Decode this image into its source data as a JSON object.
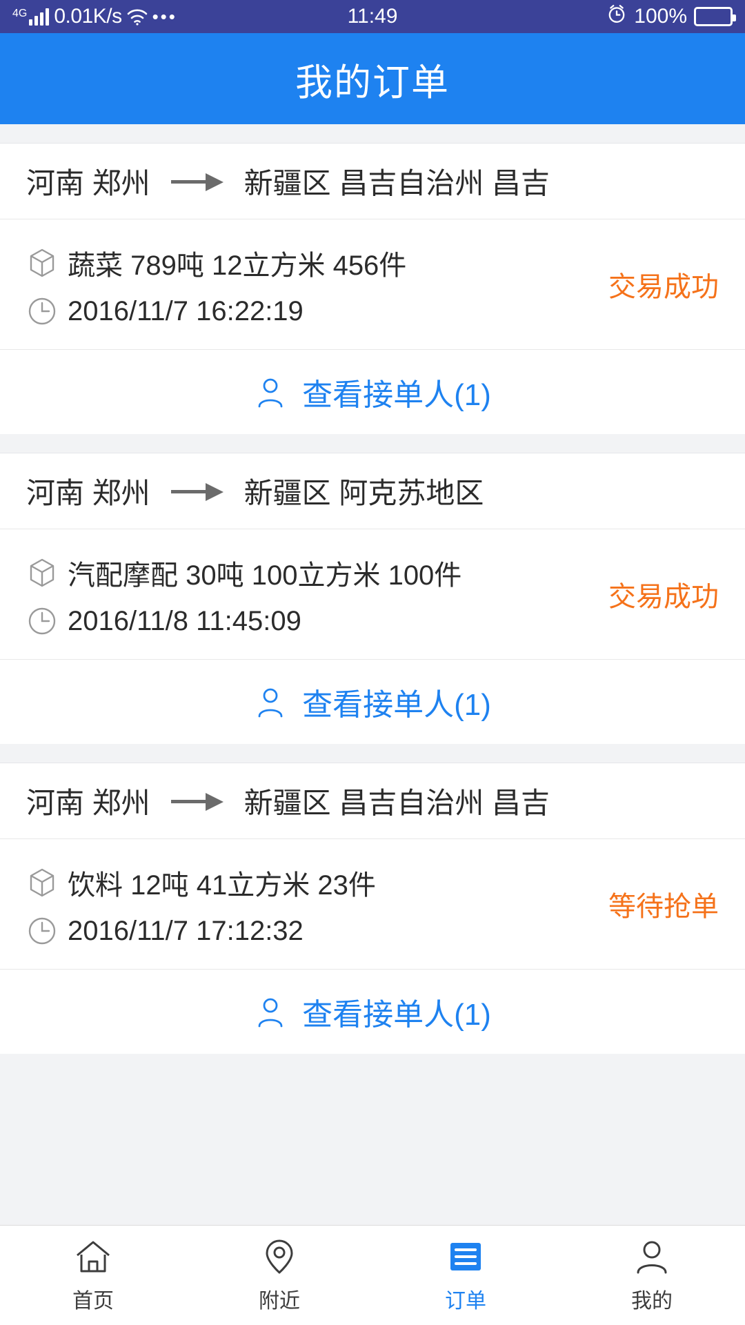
{
  "status_bar": {
    "network_type": "4G",
    "net_speed": "0.01K/s",
    "time": "11:49",
    "battery_percent": "100%",
    "icons": [
      "signal-bars-icon",
      "wifi-icon",
      "more-dots-icon",
      "alarm-clock-icon",
      "battery-icon"
    ]
  },
  "header": {
    "title": "我的订单"
  },
  "orders": [
    {
      "origin": "河南 郑州",
      "destination": "新疆区 昌吉自治州 昌吉",
      "cargo": "蔬菜 789吨 12立方米 456件",
      "time": "2016/11/7 16:22:19",
      "status": "交易成功",
      "viewer_label": "查看接单人(1)"
    },
    {
      "origin": "河南 郑州",
      "destination": "新疆区 阿克苏地区",
      "cargo": "汽配摩配 30吨 100立方米 100件",
      "time": "2016/11/8 11:45:09",
      "status": "交易成功",
      "viewer_label": "查看接单人(1)"
    },
    {
      "origin": "河南 郑州",
      "destination": "新疆区 昌吉自治州 昌吉",
      "cargo": "饮料 12吨 41立方米 23件",
      "time": "2016/11/7 17:12:32",
      "status": "等待抢单",
      "viewer_label": "查看接单人(1)"
    }
  ],
  "tabbar": {
    "items": [
      {
        "label": "首页",
        "icon": "home-icon",
        "active": false
      },
      {
        "label": "附近",
        "icon": "location-pin-icon",
        "active": false
      },
      {
        "label": "订单",
        "icon": "order-list-icon",
        "active": true
      },
      {
        "label": "我的",
        "icon": "person-icon",
        "active": false
      }
    ]
  },
  "colors": {
    "statusbar_bg": "#3b4298",
    "brand_blue": "#1e82f0",
    "status_orange": "#f5721a",
    "page_bg": "#f2f3f5",
    "text_primary": "#2b2b2b"
  }
}
